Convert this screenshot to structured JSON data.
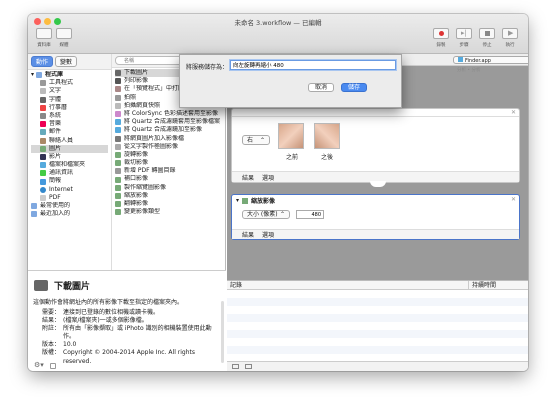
{
  "window": {
    "title": "未命名 3.workflow — 已編輯"
  },
  "toolbar": {
    "library_label": "資料庫",
    "media_label": "媒體",
    "record_label": "錄製",
    "step_label": "步驟",
    "stop_label": "停止",
    "run_label": "執行"
  },
  "library": {
    "tab_actions": "動作",
    "tab_variables": "變數",
    "search_placeholder": "名稱",
    "items": [
      "程式庫",
      "工具程式",
      "文字",
      "字體",
      "行事曆",
      "系統",
      "音樂",
      "郵件",
      "聯絡人員",
      "圖片",
      "影片",
      "檔案和檔案夾",
      "通訊資訊",
      "簡報",
      "Internet",
      "PDF",
      "最常使用的",
      "最近加入的"
    ]
  },
  "actions": [
    "下載圖片",
    "列印影像",
    "在「預覽程式」中打開",
    "拍照",
    "拍攝網頁快照",
    "將 ColorSync 色彩描述套用至影像",
    "將 Quartz 合成濾鏡套用至影像檔案",
    "將 Quartz 合成濾鏡加至影像",
    "將網頁圖片加入影像檔",
    "從文字製作極圖影像",
    "旋轉影像",
    "裁切影像",
    "新增 PDF 轉圖目錄",
    "補口影像",
    "製作縮覽圖影像",
    "縮放影像",
    "翻轉影像",
    "變更影像類型"
  ],
  "description": {
    "title": "下載圖片",
    "summary": "這個動作會將網址內的所有影像下載至指定的檔案夾內。",
    "rows": [
      {
        "k": "需要：",
        "v": "連接到已登錄的數位相機或讀卡機。"
      },
      {
        "k": "結果：",
        "v": "(檔案/檔案夾)一或多個影像檔。"
      },
      {
        "k": "附註：",
        "v": "所有由「影像擷取」或 iPhoto 識別的相機裝置使用此動作。"
      },
      {
        "k": "版本：",
        "v": "10.0"
      },
      {
        "k": "版權：",
        "v": "Copyright © 2004-2014 Apple Inc. All rights reserved."
      }
    ]
  },
  "workflow": {
    "finder_select": "Finder.app",
    "hint": "分析 • 分析"
  },
  "rotate_card": {
    "direction_value": "右",
    "before_label": "之前",
    "after_label": "之後",
    "result_tab": "結果",
    "options_tab": "選項"
  },
  "scale_card": {
    "title": "縮放影像",
    "mode_value": "大小 (像素)",
    "size_value": "480",
    "result_tab": "結果",
    "options_tab": "選項"
  },
  "log": {
    "col_log": "記錄",
    "col_duration": "持續時間"
  },
  "dialog": {
    "label": "將服務儲存為：",
    "value": "向左旋轉再縮小 480",
    "cancel_label": "取消",
    "save_label": "儲存"
  }
}
